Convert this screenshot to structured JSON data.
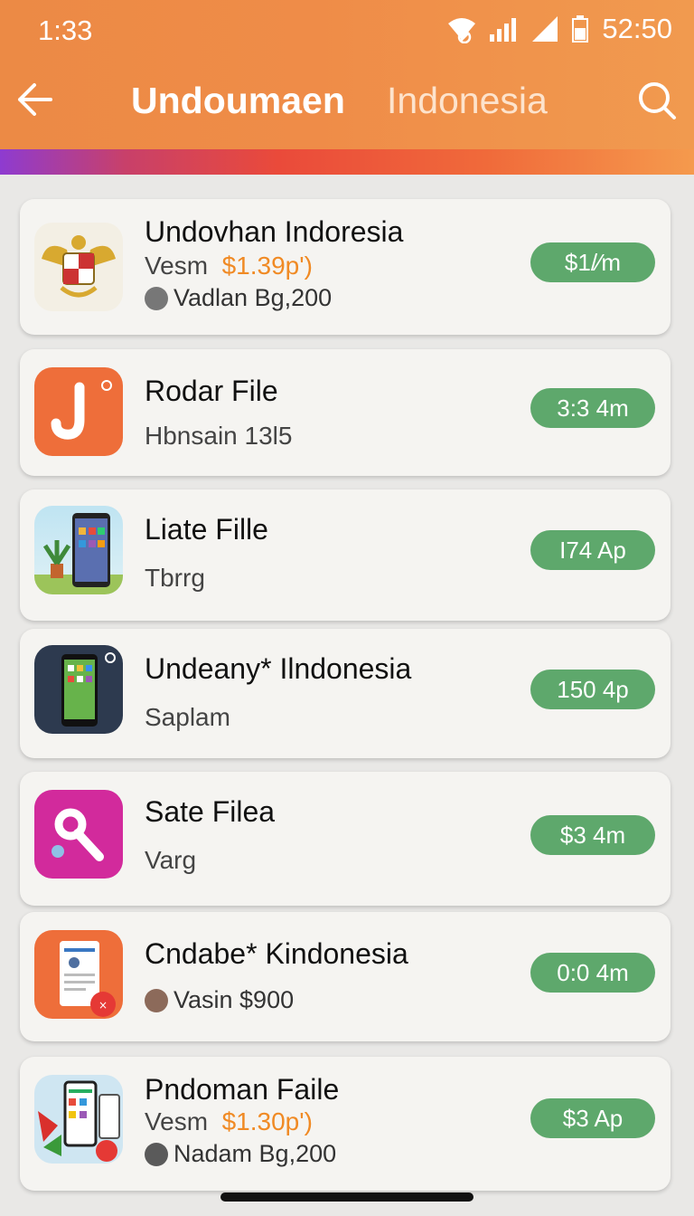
{
  "status_bar": {
    "time": "1:33",
    "battery": "52:50"
  },
  "header": {
    "title_primary": "Undoumaen",
    "title_secondary": "Indonesia",
    "back_icon": "arrow-left-icon",
    "search_icon": "search-icon"
  },
  "colors": {
    "appbar": "#ef8c48",
    "pill": "#5ea86c",
    "price": "#f08a24"
  },
  "items": [
    {
      "name": "Undovhan Indoresia",
      "sub_prefix": "Vesm",
      "price": "$1.39p')",
      "meta": "Vadlan Bg,200",
      "action": "$1/⁄m"
    },
    {
      "name": "Rodar File",
      "sub": "Hbnsain 13l5",
      "action": "3:3 4m"
    },
    {
      "name": "Liate Fille",
      "sub": "Tbrrg",
      "action": "I74 Ap"
    },
    {
      "name": "Undeany* Ilndonesia",
      "sub": "Saplam",
      "action": "150 4p"
    },
    {
      "name": "Sate Filea",
      "sub": "Varg",
      "action": "$3 4m"
    },
    {
      "name": "Cndabe* Kindonesia",
      "meta": "Vasin $900",
      "action": "0:0 4m"
    },
    {
      "name": "Pndoman Faile",
      "sub_prefix": "Vesm",
      "price": "$1.30p')",
      "meta": "Nadam Bg,200",
      "action": "$3 Ap"
    }
  ]
}
